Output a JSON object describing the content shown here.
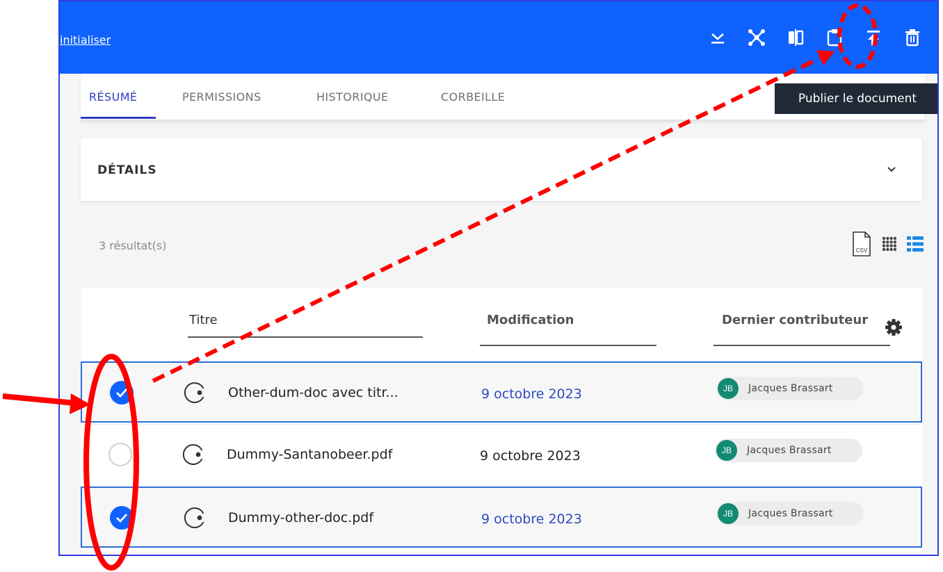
{
  "header": {
    "reset_link": "initialiser",
    "actions": [
      {
        "icon": "download-icon"
      },
      {
        "icon": "network-icon"
      },
      {
        "icon": "compare-icon"
      },
      {
        "icon": "clipboard-icon"
      },
      {
        "icon": "publish-icon"
      },
      {
        "icon": "trash-icon"
      }
    ],
    "tooltip": "Publier le document"
  },
  "tabs": [
    {
      "label": "RÉSUMÉ",
      "active": true
    },
    {
      "label": "PERMISSIONS"
    },
    {
      "label": "HISTORIQUE"
    },
    {
      "label": "CORBEILLE"
    }
  ],
  "details": {
    "title": "DÉTAILS",
    "icon": "chevron-down-icon"
  },
  "results": {
    "count_label": "3 résultat(s)"
  },
  "view_icons": [
    "csv-export-icon",
    "grid-view-icon",
    "list-view-icon"
  ],
  "table": {
    "columns": {
      "title": "Titre",
      "modified": "Modification",
      "contributor": "Dernier contributeur"
    },
    "settings_icon": "gear-icon",
    "rows": [
      {
        "selected": true,
        "title": "Other-dum-doc avec titr...",
        "date": "9 octobre 2023",
        "initials": "JB",
        "contributor": "Jacques Brassart"
      },
      {
        "selected": false,
        "title": "Dummy-Santanobeer.pdf",
        "date": "9 octobre 2023",
        "initials": "JB",
        "contributor": "Jacques Brassart"
      },
      {
        "selected": true,
        "title": "Dummy-other-doc.pdf",
        "date": "9 octobre 2023",
        "initials": "JB",
        "contributor": "Jacques Brassart"
      }
    ]
  },
  "colors": {
    "topbar": "#0f62fe",
    "active_tab": "#2f3dbf",
    "selection": "#0f62fe",
    "avatar": "#138a74",
    "annotation": "#ff0000"
  }
}
